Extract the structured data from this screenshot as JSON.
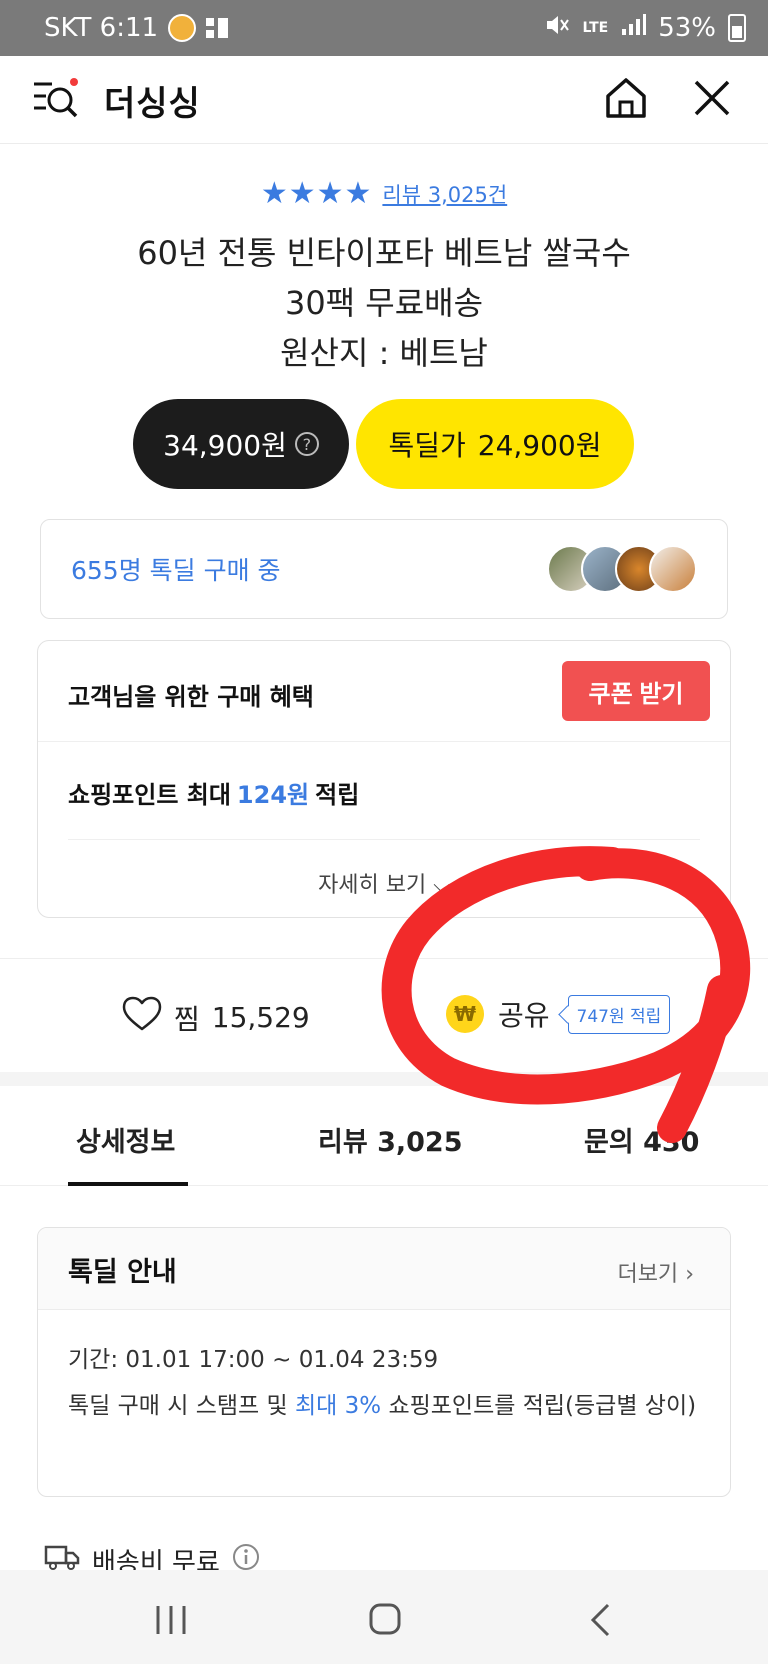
{
  "status_bar": {
    "carrier_time": "SKT 6:11",
    "network": "LTE",
    "battery": "53%"
  },
  "header": {
    "brand": "더싱싱",
    "icons": [
      "menu-search-icon",
      "home-icon",
      "close-icon"
    ]
  },
  "product": {
    "rating_stars": "★★★★",
    "review_link": "리뷰 3,025건",
    "title_line1": "60년 전통 빈타이포타 베트남 쌀국수",
    "title_line2": "30팩 무료배송",
    "title_line3": "원산지 : 베트남"
  },
  "price": {
    "regular": "34,900원",
    "deal_label": "톡딜가",
    "deal_price": "24,900원"
  },
  "buyers": {
    "text": "655명 톡딜 구매 중"
  },
  "benefit": {
    "heading": "고객님을 위한 구매 혜택",
    "coupon_button": "쿠폰 받기",
    "points_prefix": "쇼핑포인트 최대",
    "points_value": "124원",
    "points_suffix": "적립",
    "more": "자세히 보기 ⌵"
  },
  "actions": {
    "like_label": "찜",
    "like_count": "15,529",
    "share_label": "공유",
    "share_earn": "747원 적립",
    "coin_symbol": "₩"
  },
  "tabs": [
    {
      "label": "상세정보"
    },
    {
      "label": "리뷰 3,025"
    },
    {
      "label": "문의 430"
    }
  ],
  "deal_info": {
    "title": "톡딜 안내",
    "more": "더보기",
    "period": "기간: 01.01 17:00 ~ 01.04 23:59",
    "desc_prefix": "톡딜 구매 시 스탬프 및",
    "desc_highlight": "최대 3%",
    "desc_suffix": "쇼핑포인트를 적립(등급별 상이)"
  },
  "shipping": {
    "label": "배송비 무료"
  },
  "colors": {
    "accent_blue": "#3b7be0",
    "deal_yellow": "#ffe500",
    "coupon_red": "#f15151",
    "annotation_red": "#f22a2a"
  }
}
